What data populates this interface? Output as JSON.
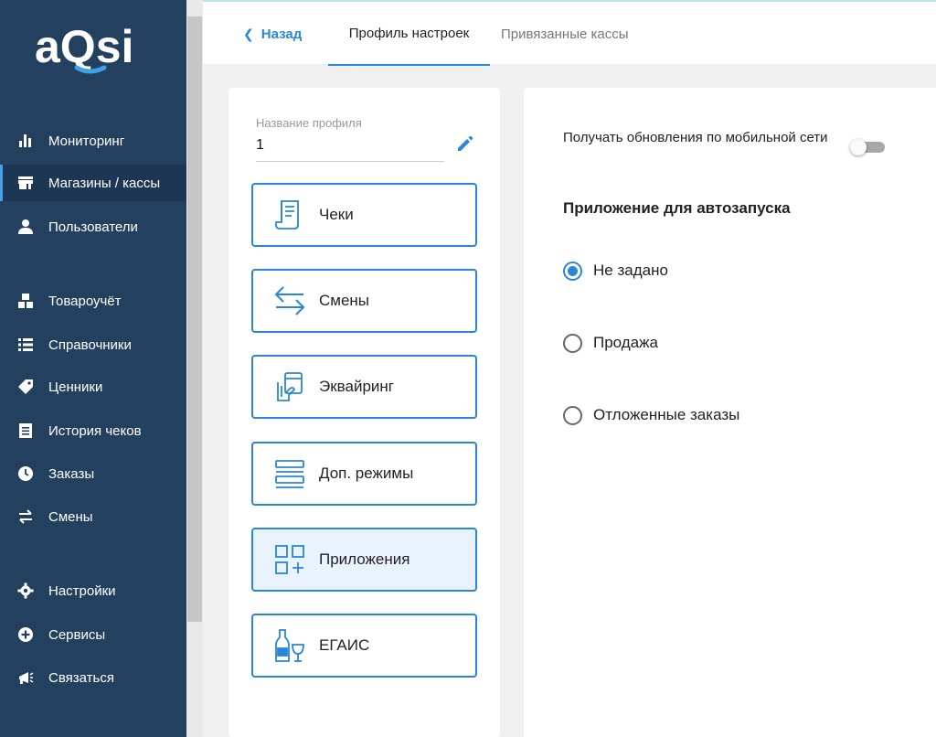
{
  "app": {
    "logo_text": "aQsi"
  },
  "sidebar": {
    "items": [
      {
        "label": "Мониторинг",
        "icon": "bar-chart-icon"
      },
      {
        "label": "Магазины / кассы",
        "icon": "store-icon"
      },
      {
        "label": "Пользователи",
        "icon": "user-icon"
      },
      {
        "label": "Товароучёт",
        "icon": "boxes-icon"
      },
      {
        "label": "Справочники",
        "icon": "list-icon"
      },
      {
        "label": "Ценники",
        "icon": "tag-icon"
      },
      {
        "label": "История чеков",
        "icon": "receipt-icon"
      },
      {
        "label": "Заказы",
        "icon": "clock-icon"
      },
      {
        "label": "Смены",
        "icon": "swap-icon"
      },
      {
        "label": "Настройки",
        "icon": "gear-icon"
      },
      {
        "label": "Сервисы",
        "icon": "plus-circle-icon"
      },
      {
        "label": "Связаться",
        "icon": "megaphone-icon"
      }
    ],
    "active_item": "Магазины / кассы"
  },
  "tabs": {
    "back": "Назад",
    "profile": "Профиль настроек",
    "linked": "Привязанные кассы"
  },
  "profile": {
    "name_label": "Название профиля",
    "name_value": "1"
  },
  "categories": [
    {
      "label": "Чеки",
      "icon": "receipt-doc-icon"
    },
    {
      "label": "Смены",
      "icon": "arrows-swap-icon"
    },
    {
      "label": "Эквайринг",
      "icon": "card-hand-icon"
    },
    {
      "label": "Доп. режимы",
      "icon": "stack-lines-icon"
    },
    {
      "label": "Приложения",
      "icon": "apps-grid-icon"
    },
    {
      "label": "ЕГАИС",
      "icon": "bottle-glass-icon"
    }
  ],
  "active_category": "Приложения",
  "settings": {
    "mobile_updates_label": "Получать обновления по мобильной сети",
    "mobile_updates_enabled": false,
    "autostart_title": "Приложение для автозапуска",
    "autostart_options": [
      "Не задано",
      "Продажа",
      "Отложенные заказы"
    ],
    "autostart_selected": "Не задано"
  },
  "colors": {
    "sidebar_bg": "#24405f",
    "accent": "#2a86d6",
    "active_card_bg": "#e9f3fd"
  }
}
